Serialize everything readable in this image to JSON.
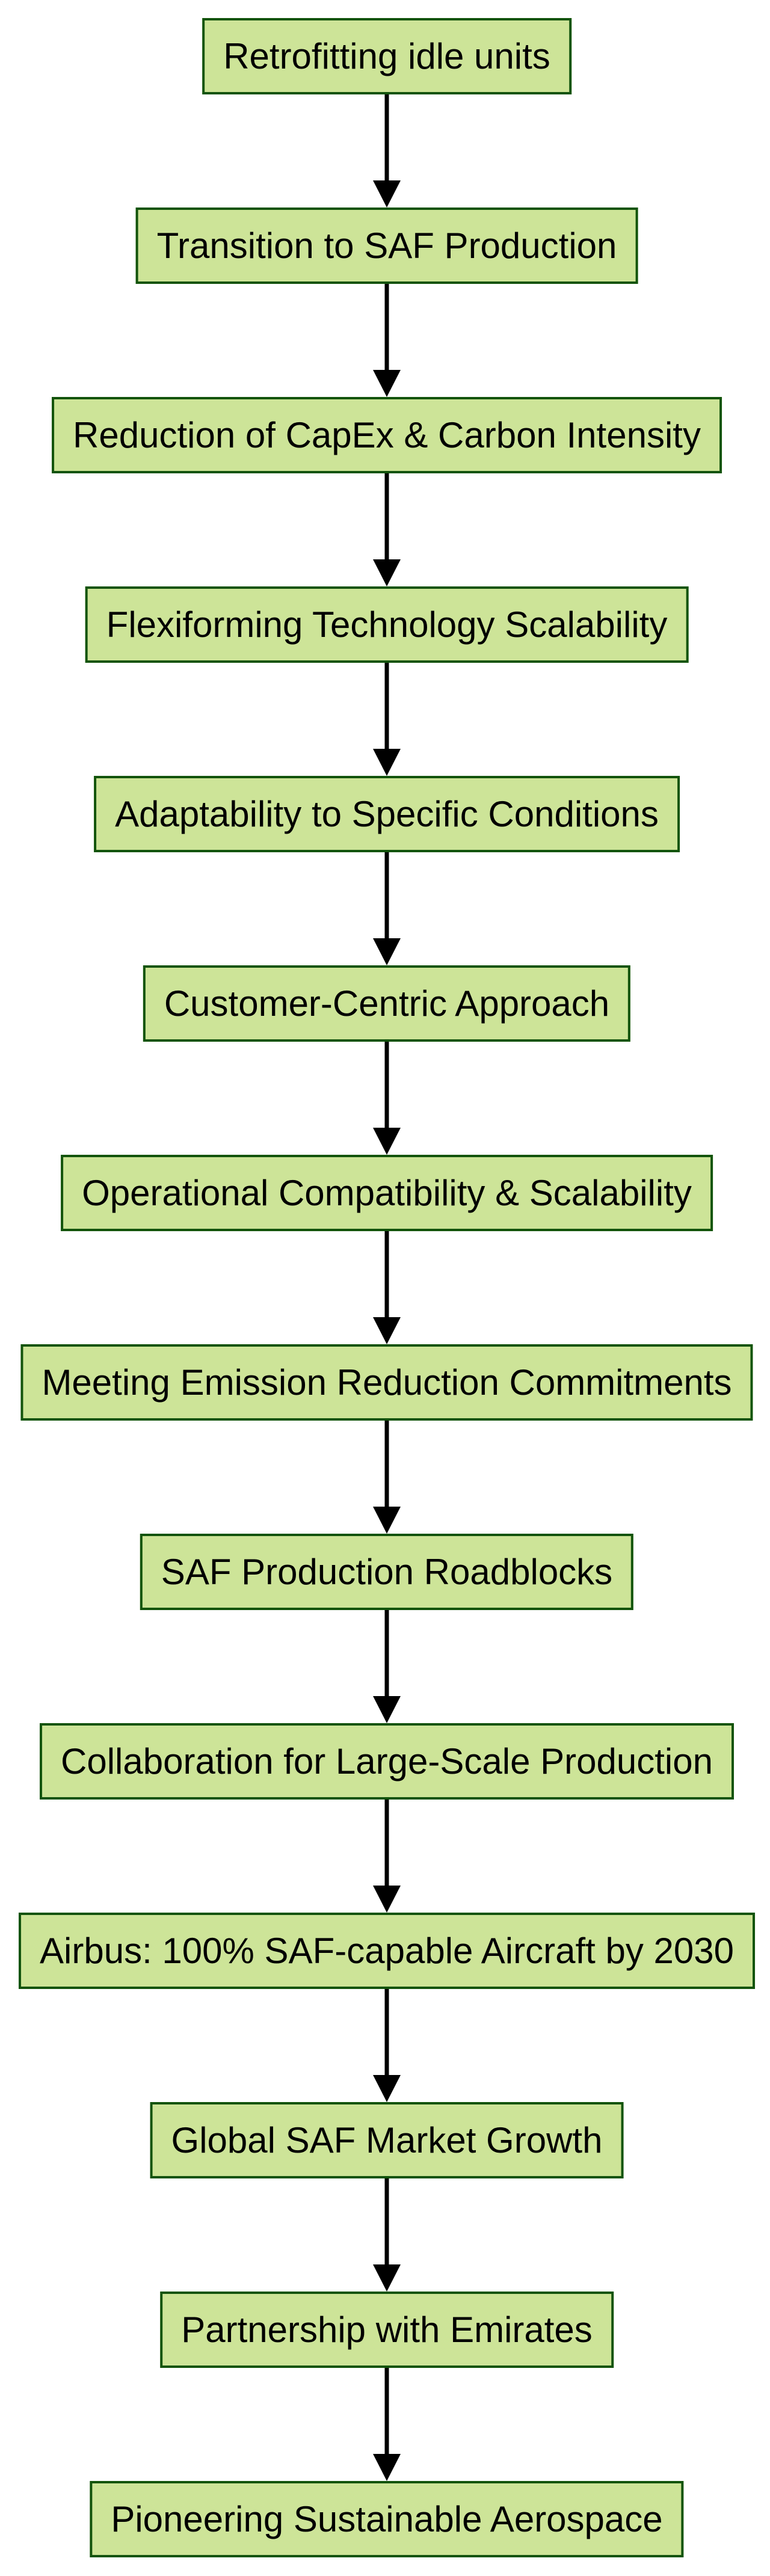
{
  "diagram": {
    "type": "flowchart",
    "direction": "top-to-bottom",
    "colors": {
      "node_fill": "#cde498",
      "node_border": "#13540c",
      "edge": "#000000",
      "text": "#000000"
    },
    "nodes": [
      {
        "id": "n1",
        "label": "Retrofitting idle units"
      },
      {
        "id": "n2",
        "label": "Transition to SAF Production"
      },
      {
        "id": "n3",
        "label": "Reduction of CapEx & Carbon Intensity"
      },
      {
        "id": "n4",
        "label": "Flexiforming Technology Scalability"
      },
      {
        "id": "n5",
        "label": "Adaptability to Specific Conditions"
      },
      {
        "id": "n6",
        "label": "Customer-Centric Approach"
      },
      {
        "id": "n7",
        "label": "Operational Compatibility & Scalability"
      },
      {
        "id": "n8",
        "label": "Meeting Emission Reduction Commitments"
      },
      {
        "id": "n9",
        "label": "SAF Production Roadblocks"
      },
      {
        "id": "n10",
        "label": "Collaboration for Large-Scale Production"
      },
      {
        "id": "n11",
        "label": "Airbus: 100% SAF-capable Aircraft by 2030"
      },
      {
        "id": "n12",
        "label": "Global SAF Market Growth"
      },
      {
        "id": "n13",
        "label": "Partnership with Emirates"
      },
      {
        "id": "n14",
        "label": "Pioneering Sustainable Aerospace"
      }
    ],
    "edges": [
      {
        "from": "n1",
        "to": "n2"
      },
      {
        "from": "n2",
        "to": "n3"
      },
      {
        "from": "n3",
        "to": "n4"
      },
      {
        "from": "n4",
        "to": "n5"
      },
      {
        "from": "n5",
        "to": "n6"
      },
      {
        "from": "n6",
        "to": "n7"
      },
      {
        "from": "n7",
        "to": "n8"
      },
      {
        "from": "n8",
        "to": "n9"
      },
      {
        "from": "n9",
        "to": "n10"
      },
      {
        "from": "n10",
        "to": "n11"
      },
      {
        "from": "n11",
        "to": "n12"
      },
      {
        "from": "n12",
        "to": "n13"
      },
      {
        "from": "n13",
        "to": "n14"
      }
    ]
  }
}
